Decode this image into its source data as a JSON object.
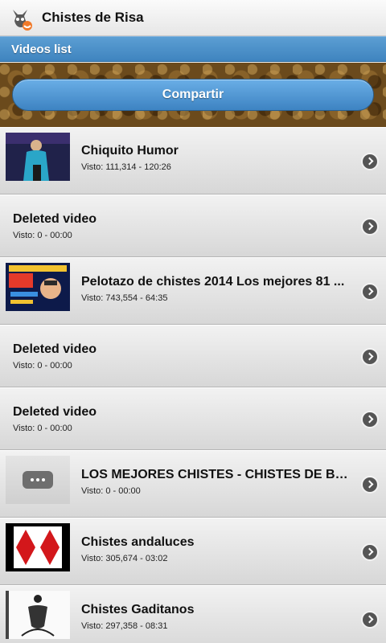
{
  "app": {
    "title": "Chistes de Risa",
    "icon": "cat-mascot-icon"
  },
  "subheader": {
    "label": "Videos list"
  },
  "share_button": {
    "label": "Compartir"
  },
  "videos": [
    {
      "title": "Chiquito Humor",
      "meta": "Visto: 111,314 - 120:26",
      "thumb": "performer"
    },
    {
      "title": "Deleted video",
      "meta": "Visto: 0 - 00:00",
      "thumb": "none"
    },
    {
      "title": "Pelotazo de chistes 2014 Los mejores 81 ...",
      "meta": "Visto: 743,554 - 64:35",
      "thumb": "poster"
    },
    {
      "title": "Deleted video",
      "meta": "Visto: 0 - 00:00",
      "thumb": "none"
    },
    {
      "title": "Deleted video",
      "meta": "Visto: 0 - 00:00",
      "thumb": "none"
    },
    {
      "title": "LOS MEJORES CHISTES - CHISTES DE BO...",
      "meta": "Visto: 0 - 00:00",
      "thumb": "placeholder"
    },
    {
      "title": "Chistes andaluces",
      "meta": "Visto: 305,674 - 03:02",
      "thumb": "diamonds"
    },
    {
      "title": "Chistes Gaditanos",
      "meta": "Visto: 297,358 - 08:31",
      "thumb": "sketch"
    }
  ]
}
